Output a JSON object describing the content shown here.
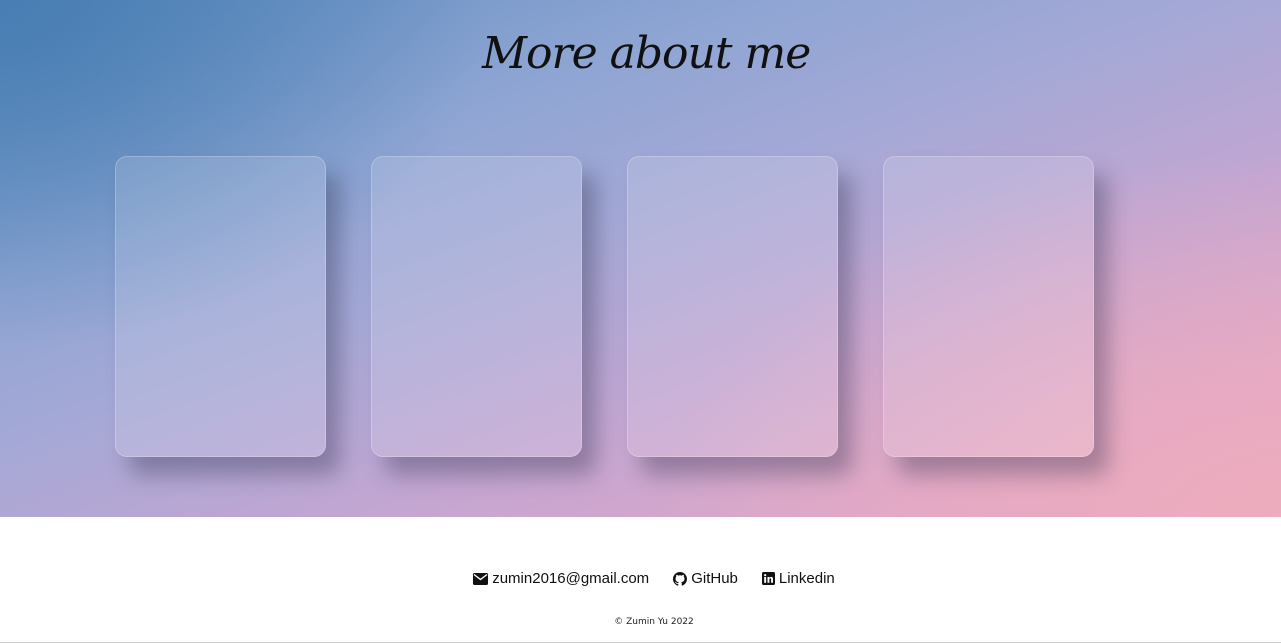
{
  "about": {
    "title": "More about me",
    "cards": [
      {},
      {},
      {},
      {}
    ]
  },
  "footer": {
    "links": [
      {
        "label": "zumin2016@gmail.com",
        "icon": "envelope-icon"
      },
      {
        "label": "GitHub",
        "icon": "github-icon"
      },
      {
        "label": "Linkedin",
        "icon": "linkedin-icon"
      }
    ],
    "copyright": "© Zumin Yu 2022"
  },
  "colors": {
    "gradient_start": "#4a7fb5",
    "gradient_mid": "#a8acd8",
    "gradient_end": "#e8a9bd",
    "text": "#111111"
  }
}
